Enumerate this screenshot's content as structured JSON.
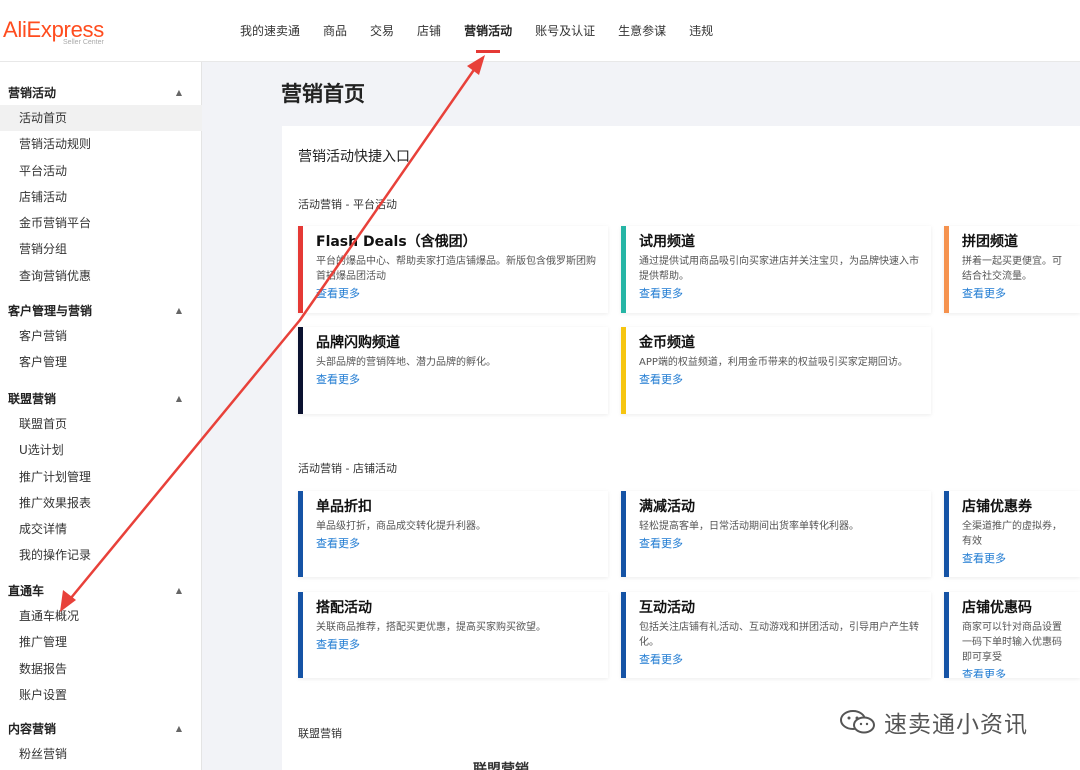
{
  "brand": {
    "logo": "AliExpress",
    "logo_sub": "Seller Center"
  },
  "topnav": [
    {
      "label": "我的速卖通",
      "active": false
    },
    {
      "label": "商品",
      "active": false
    },
    {
      "label": "交易",
      "active": false
    },
    {
      "label": "店铺",
      "active": false
    },
    {
      "label": "营销活动",
      "active": true
    },
    {
      "label": "账号及认证",
      "active": false
    },
    {
      "label": "生意参谋",
      "active": false
    },
    {
      "label": "违规",
      "active": false
    }
  ],
  "sidebar": [
    {
      "title": "营销活动",
      "items": [
        "活动首页",
        "营销活动规则",
        "平台活动",
        "店铺活动",
        "金币营销平台",
        "营销分组",
        "查询营销优惠"
      ]
    },
    {
      "title": "客户管理与营销",
      "items": [
        "客户营销",
        "客户管理"
      ]
    },
    {
      "title": "联盟营销",
      "items": [
        "联盟首页",
        "U选计划",
        "推广计划管理",
        "推广效果报表",
        "成交详情",
        "我的操作记录"
      ]
    },
    {
      "title": "直通车",
      "items": [
        "直通车概况",
        "推广管理",
        "数据报告",
        "账户设置"
      ]
    },
    {
      "title": "内容营销",
      "items": [
        "粉丝营销"
      ]
    }
  ],
  "main": {
    "page_title": "营销首页",
    "panel_title": "营销活动快捷入口",
    "sections": [
      "活动营销 - 平台活动",
      "活动营销 - 店铺活动",
      "联盟营销"
    ],
    "platform_cards": [
      {
        "title": "Flash Deals（含俄团）",
        "desc": "平台的爆品中心、帮助卖家打造店铺爆品。新版包含俄罗斯团购首招爆品团活动",
        "more": "查看更多",
        "color": "#e53935"
      },
      {
        "title": "试用频道",
        "desc": "通过提供试用商品吸引向买家进店并关注宝贝，为品牌快速入市提供帮助。",
        "more": "查看更多",
        "color": "#26b5a5"
      },
      {
        "title": "拼团频道",
        "desc": "拼着一起买更便宜。可结合社交流量。",
        "more": "查看更多",
        "color": "#f5924e"
      },
      {
        "title": "品牌闪购频道",
        "desc": "头部品牌的营销阵地、潜力品牌的孵化。",
        "more": "查看更多",
        "color": "#0b1230"
      },
      {
        "title": "金币频道",
        "desc": "APP端的权益频道，利用金币带来的权益吸引买家定期回访。",
        "more": "查看更多",
        "color": "#f6c510"
      }
    ],
    "store_cards": [
      {
        "title": "单品折扣",
        "desc": "单品级打折，商品成交转化提升利器。",
        "more": "查看更多",
        "color": "#1553a5"
      },
      {
        "title": "满减活动",
        "desc": "轻松提高客单，日常活动期间出货率单转化利器。",
        "more": "查看更多",
        "color": "#1553a5"
      },
      {
        "title": "店铺优惠券",
        "desc": "全渠道推广的虚拟券，有效",
        "more": "查看更多",
        "color": "#1553a5"
      },
      {
        "title": "搭配活动",
        "desc": "关联商品推荐，搭配买更优惠，提高买家购买欲望。",
        "more": "查看更多",
        "color": "#1553a5"
      },
      {
        "title": "互动活动",
        "desc": "包括关注店铺有礼活动、互动游戏和拼团活动，引导用户产生转化。",
        "more": "查看更多",
        "color": "#1553a5"
      },
      {
        "title": "店铺优惠码",
        "desc": "商家可以针对商品设置一码下单时输入优惠码即可享受",
        "more": "查看更多",
        "color": "#1553a5"
      }
    ],
    "partial_card_title": "联盟营销"
  },
  "watermark": {
    "text": "速卖通小资讯"
  },
  "colors": {
    "accent": "#e53935",
    "link": "#1e7ad2",
    "brand": "#ff4c1e"
  }
}
